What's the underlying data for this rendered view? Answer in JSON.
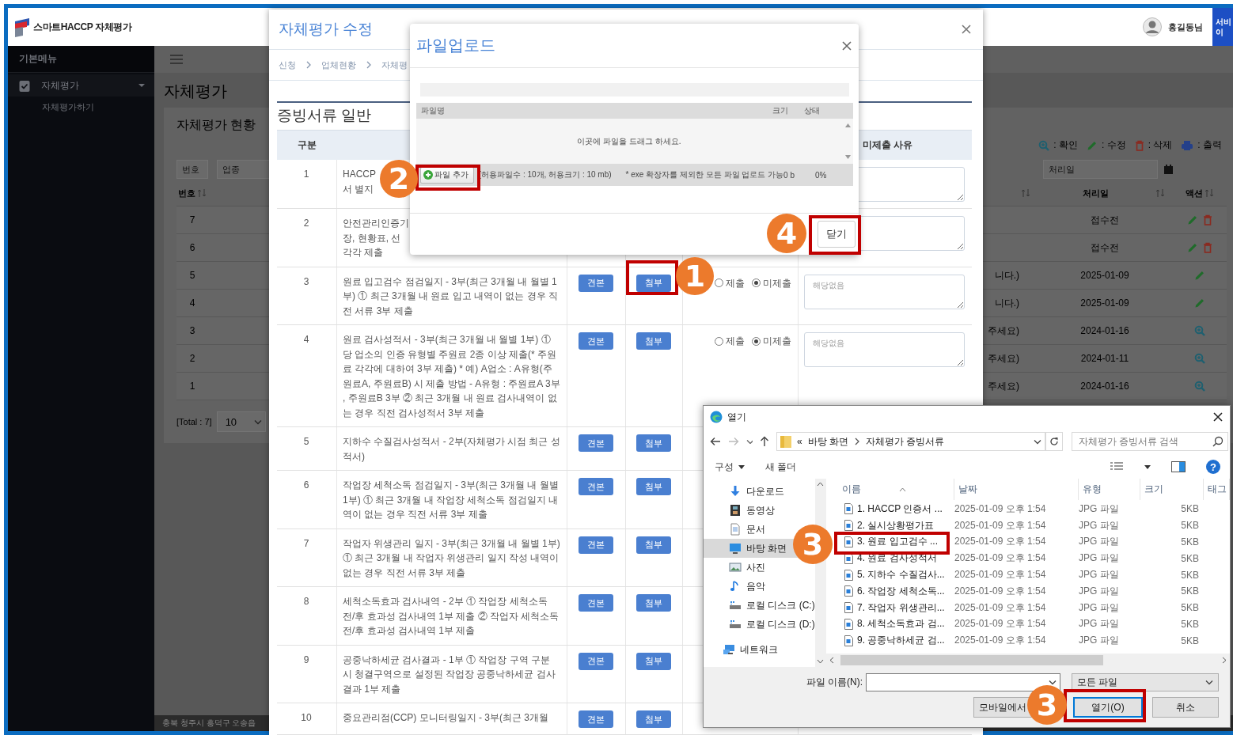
{
  "app": {
    "logo_text": "스마트HACCP 자체평가",
    "user_name": "홍길동님",
    "header_button_lines": [
      "서비",
      "이"
    ]
  },
  "sidebar": {
    "heading": "기본메뉴",
    "items": [
      {
        "label": "자체평가",
        "expanded": true,
        "children": [
          {
            "label": "자체평가하기"
          }
        ]
      }
    ]
  },
  "page": {
    "title": "자체평가",
    "panel_title": "자체평가 현황",
    "legend": [
      {
        "kind": "view",
        "label": ": 확인"
      },
      {
        "kind": "edit",
        "label": ": 수정"
      },
      {
        "kind": "delete",
        "label": ": 삭제"
      },
      {
        "kind": "print",
        "label": ": 출력"
      }
    ],
    "filters": [
      {
        "placeholder": "번호"
      },
      {
        "placeholder": "업종"
      },
      {
        "placeholder": "처리일"
      }
    ],
    "columns": {
      "number": "번호",
      "processed": "처리일",
      "actions": "액션"
    },
    "rows": [
      {
        "number": "7",
        "processed": "접수전",
        "actions": [
          {
            "kind": "edit"
          },
          {
            "kind": "delete"
          }
        ]
      },
      {
        "number": "6",
        "processed": "접수전",
        "actions": [
          {
            "kind": "edit"
          },
          {
            "kind": "delete"
          }
        ]
      },
      {
        "number": "5",
        "column_3": "니다.)",
        "processed": "2025-01-09",
        "actions": [
          {
            "kind": "edit"
          }
        ]
      },
      {
        "number": "4",
        "column_3": "니다.)",
        "processed": "2025-01-09",
        "actions": [
          {
            "kind": "edit"
          }
        ]
      },
      {
        "number": "3",
        "column_3": "주세요)",
        "processed": "2024-01-16",
        "actions": [
          {
            "kind": "view"
          }
        ]
      },
      {
        "number": "2",
        "column_3": "주세요)",
        "processed": "2024-01-11",
        "actions": [
          {
            "kind": "view"
          }
        ]
      },
      {
        "number": "1",
        "column_3": "주세요)",
        "processed": "2024-01-16",
        "actions": [
          {
            "kind": "view"
          }
        ]
      }
    ],
    "total": "[Total : 7]",
    "page_size": "10"
  },
  "footer": "충북 청주시 흥덕구 오송읍",
  "edit_modal": {
    "title": "자체평가 수정",
    "breadcrumb": [
      "신청",
      "업체현황",
      "자체평"
    ],
    "section_title": "증빙서류 일반",
    "number_header": "구분",
    "reason_header": "미제출 사유",
    "rows": [
      {
        "number": "1",
        "text_lines": [
          "HACCP",
          "서 별지"
        ],
        "reason_field": true
      },
      {
        "number": "2",
        "text_lines": [
          "안전관리인증기",
          "장, 현황표, 선",
          "각각 제출"
        ],
        "reason_field": true
      },
      {
        "number": "3",
        "text": "원료 입고검수 점검일지 - 3부(최근 3개월 내 월별 1부) ① 최근 3개월 내 원료 입고 내역이 없는 경우 직전 서류 3부 제출",
        "buttons": [
          "견본",
          "첨부"
        ],
        "submission": [
          {
            "label": "제출",
            "selected": false
          },
          {
            "label": "미제출",
            "selected": true
          }
        ],
        "reason_placeholder": "해당없음"
      },
      {
        "number": "4",
        "text": "원료 검사성적서 - 3부(최근 3개월 내 월별 1부) ① 당 업소의 인증 유형별 주원료 2종 이상 제출(* 주원료 각각에 대하여 3부 제출) * 예) A업소 : A유형(주원료A, 주원료B) 시 제출 방법 - A유형 : 주원료A 3부 , 주원료B 3부 ② 최근 3개월 내 원료 검사내역이 없는 경우 직전 검사성적서 3부 제출",
        "buttons": [
          "견본",
          "첨부"
        ],
        "submission": [
          {
            "label": "제출",
            "selected": false
          },
          {
            "label": "미제출",
            "selected": true
          }
        ],
        "reason_placeholder": "해당없음"
      },
      {
        "number": "5",
        "text": "지하수 수질검사성적서 - 2부(자체평가 시점 최근 성적서)",
        "buttons": [
          "견본",
          "첨부"
        ]
      },
      {
        "number": "6",
        "text": "작업장 세척소독 점검일지 - 3부(최근 3개월 내 월별 1부) ① 최근 3개월 내 작업장 세척소독 점검일지 내역이 없는 경우 직전 서류 3부 제출",
        "buttons": [
          "견본",
          "첨부"
        ]
      },
      {
        "number": "7",
        "text": "작업자 위생관리 일지 - 3부(최근 3개월 내 월별 1부) ① 최근 3개월 내 작업자 위생관리 일지 작성 내역이 없는 경우 직전 서류 3부 제출",
        "buttons": [
          "견본",
          "첨부"
        ]
      },
      {
        "number": "8",
        "text": "세척소독효과 검사내역 - 2부 ① 작업장 세척소독 전/후 효과성 검사내역 1부 제출 ② 작업자 세척소독 전/후 효과성 검사내역 1부 제출",
        "buttons": [
          "견본",
          "첨부"
        ]
      },
      {
        "number": "9",
        "text": "공중낙하세균 검사결과 - 1부 ① 작업장 구역 구분 시 청결구역으로 설정된 작업장 공중낙하세균 검사결과 1부 제출",
        "buttons": [
          "견본",
          "첨부"
        ]
      },
      {
        "number": "10",
        "text_lines": [
          "중요관리점(CCP) 모니터링일지 - 3부(최근 3개월"
        ],
        "buttons": [
          "견본",
          "첨부"
        ]
      }
    ]
  },
  "upload_dialog": {
    "title": "파일업로드",
    "columns": [
      "파일명",
      "크기",
      "상태"
    ],
    "drop_hint": "이곳에 파일을 드래그 하세요.",
    "add_button": "파일 추가",
    "limits": "(허용파일수 : 10개, 허용크기 : 10 mb)",
    "note": "* exe 확장자를 제외한 모든 파일 업로드 가능",
    "total_size": "0 b",
    "progress": "0%",
    "close_button": "닫기"
  },
  "file_dialog": {
    "title": "열기",
    "path_prefix": "«",
    "path": [
      "바탕 화면",
      "자체평가 증빙서류"
    ],
    "search_placeholder": "자체평가 증빙서류 검색",
    "toolbar": [
      "구성",
      "새 폴더"
    ],
    "help": "?",
    "nav": [
      {
        "kind": "download",
        "label": "다운로드",
        "selected": false
      },
      {
        "kind": "video",
        "label": "동영상",
        "selected": false
      },
      {
        "kind": "document",
        "label": "문서",
        "selected": false
      },
      {
        "kind": "desktop",
        "label": "바탕 화면",
        "selected": true
      },
      {
        "kind": "picture",
        "label": "사진",
        "selected": false
      },
      {
        "kind": "music",
        "label": "음악",
        "selected": false
      },
      {
        "kind": "drive",
        "label": "로컬 디스크 (C:)",
        "selected": false
      },
      {
        "kind": "drive",
        "label": "로컬 디스크 (D:)",
        "selected": false
      },
      {
        "kind": "network",
        "label": "네트워크",
        "selected": false
      }
    ],
    "columns": [
      "이름",
      "날짜",
      "유형",
      "크기",
      "태그"
    ],
    "files": [
      {
        "name": "1. HACCP 인증서 ...",
        "date": "2025-01-09 오후 1:54",
        "type": "JPG 파일",
        "size": "5KB"
      },
      {
        "name": "2. 실시상황평가표",
        "date": "2025-01-09 오후 1:54",
        "type": "JPG 파일",
        "size": "5KB"
      },
      {
        "name": "3. 원료 입고검수 ...",
        "date": "2025-01-09 오후 1:54",
        "type": "JPG 파일",
        "size": "5KB"
      },
      {
        "name": "4. 원료 검사성적서",
        "date": "2025-01-09 오후 1:54",
        "type": "JPG 파일",
        "size": "5KB"
      },
      {
        "name": "5. 지하수 수질검사...",
        "date": "2025-01-09 오후 1:54",
        "type": "JPG 파일",
        "size": "5KB"
      },
      {
        "name": "6. 작업장 세척소독...",
        "date": "2025-01-09 오후 1:54",
        "type": "JPG 파일",
        "size": "5KB"
      },
      {
        "name": "7. 작업자 위생관리...",
        "date": "2025-01-09 오후 1:54",
        "type": "JPG 파일",
        "size": "5KB"
      },
      {
        "name": "8. 세척소독효과 검...",
        "date": "2025-01-09 오후 1:54",
        "type": "JPG 파일",
        "size": "5KB"
      },
      {
        "name": "9. 공중낙하세균 검...",
        "date": "2025-01-09 오후 1:54",
        "type": "JPG 파일",
        "size": "5KB"
      }
    ],
    "filename_label": "파일 이름(N):",
    "filter": "모든 파일",
    "buttons": [
      "모바일에서",
      "열기(O)",
      "취소"
    ]
  },
  "callouts": [
    {
      "number": "1"
    },
    {
      "number": "2"
    },
    {
      "number": "3"
    },
    {
      "number": "3"
    },
    {
      "number": "4"
    }
  ]
}
